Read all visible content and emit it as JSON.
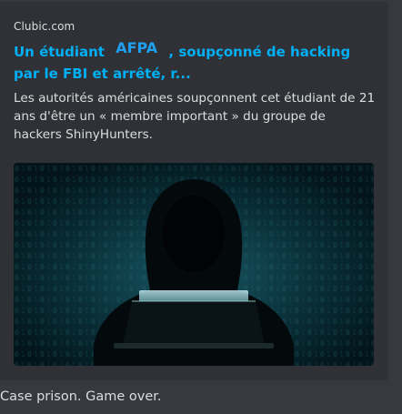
{
  "embed": {
    "provider": "Clubic.com",
    "title_part1": "Un étudiant ",
    "title_redaction": "AFPA",
    "title_part2": " , soupçonné de hacking par le FBI et arrêté, r...",
    "description": "Les autorités américaines soupçonnent cet étudiant de 21 ans d'être un « membre important » du groupe de hackers ShinyHunters.",
    "image_icon": "hooded-hacker-laptop-image"
  },
  "message": {
    "text": "Case prison. Game over."
  },
  "colors": {
    "background": "#36393f",
    "embed_background": "#2f3136",
    "link": "#00aff4",
    "text": "#dcddde"
  }
}
